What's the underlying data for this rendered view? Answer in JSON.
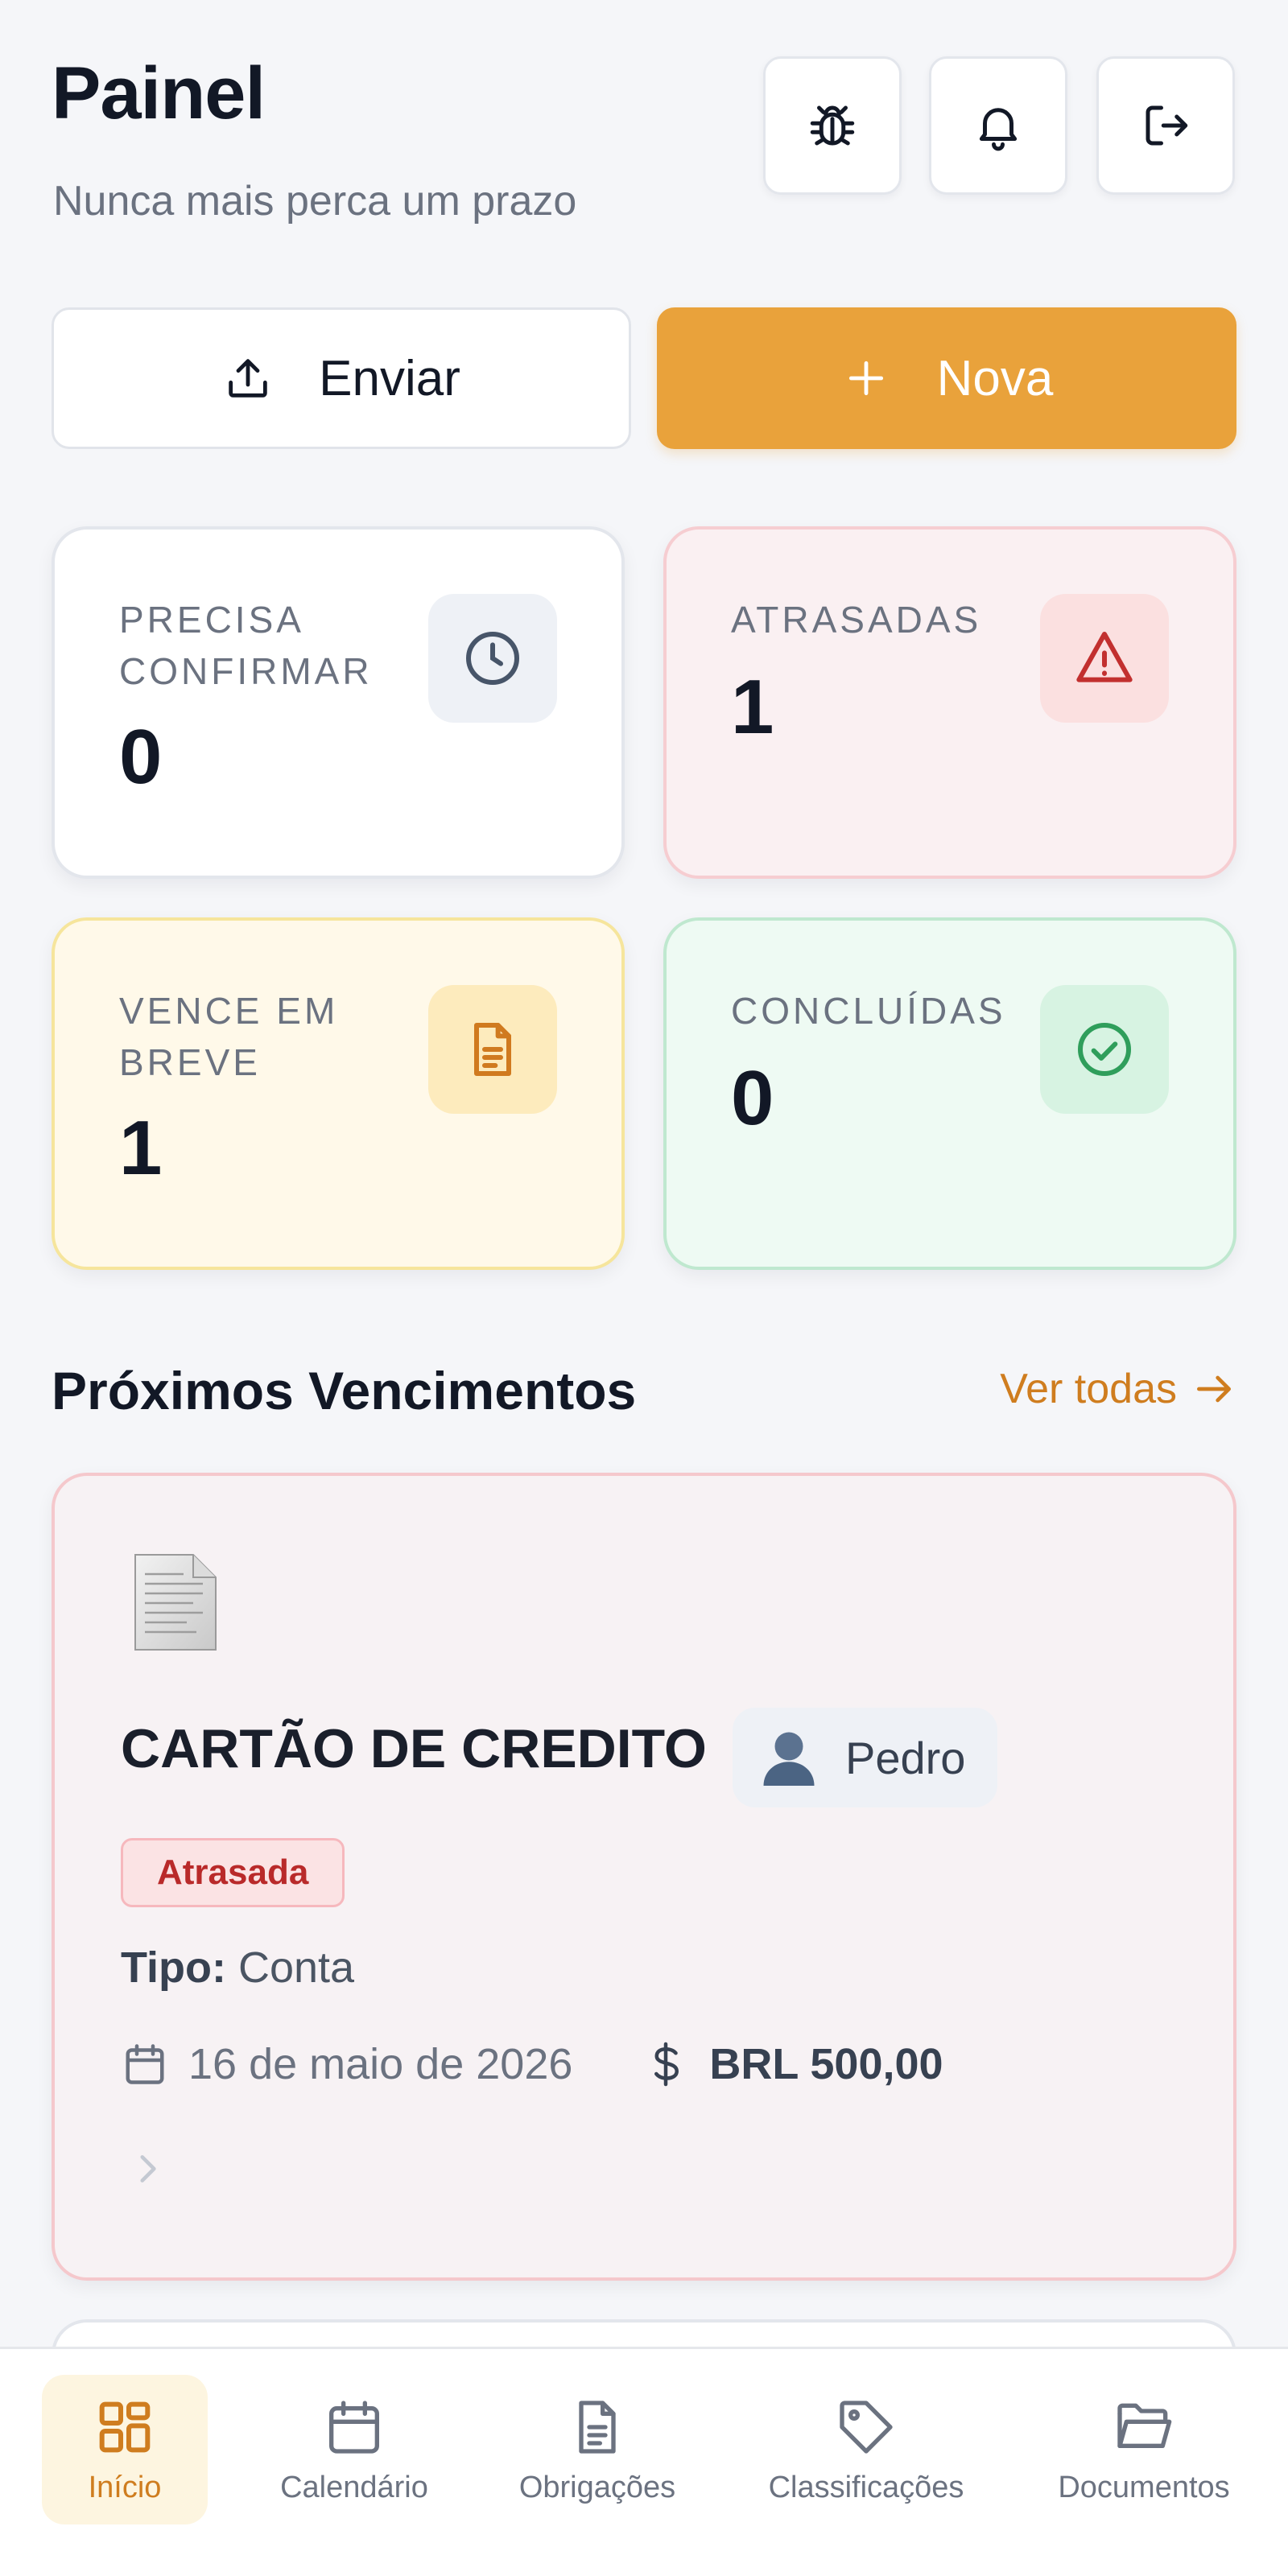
{
  "header": {
    "title": "Painel",
    "subtitle": "Nunca mais perca um prazo",
    "icons": [
      "bug-icon",
      "bell-icon",
      "logout-icon"
    ]
  },
  "actions": {
    "send_label": "Enviar",
    "new_label": "Nova"
  },
  "stats": [
    {
      "label": "PRECISA CONFIRMAR",
      "value": "0",
      "icon": "clock-icon",
      "accent": "#475569"
    },
    {
      "label": "ATRASADAS",
      "value": "1",
      "icon": "warning-icon",
      "accent": "#c2302f"
    },
    {
      "label": "VENCE EM BREVE",
      "value": "1",
      "icon": "document-icon",
      "accent": "#d07a1f"
    },
    {
      "label": "CONCLUÍDAS",
      "value": "0",
      "icon": "check-circle-icon",
      "accent": "#2f9e5b"
    }
  ],
  "upcoming": {
    "title": "Próximos Vencimentos",
    "see_all": "Ver todas",
    "items": [
      {
        "name": "CARTÃO DE CREDITO",
        "owner": "Pedro",
        "status": "Atrasada",
        "type_label": "Tipo:",
        "type_value": "Conta",
        "date": "16 de maio de 2026",
        "amount": "BRL 500,00"
      }
    ]
  },
  "nav": {
    "items": [
      {
        "label": "Início",
        "icon": "grid-icon",
        "active": true
      },
      {
        "label": "Calendário",
        "icon": "calendar-icon",
        "active": false
      },
      {
        "label": "Obrigações",
        "icon": "document-icon",
        "active": false
      },
      {
        "label": "Classificações",
        "icon": "tag-icon",
        "active": false
      },
      {
        "label": "Documentos",
        "icon": "folder-icon",
        "active": false
      }
    ]
  },
  "colors": {
    "brand": "#e9a23b",
    "brand_text": "#cf7d1f",
    "late_text": "#b92a2a"
  }
}
